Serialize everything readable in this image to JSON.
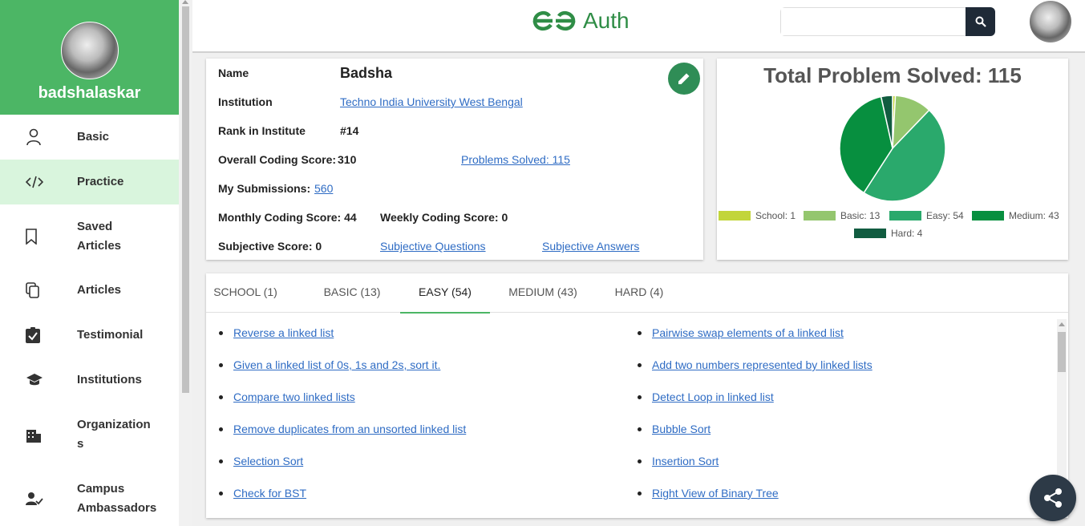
{
  "sidebar": {
    "username": "badshalaskar",
    "items": [
      {
        "label": "Basic",
        "icon": "person-icon"
      },
      {
        "label": "Practice",
        "icon": "code-icon",
        "active": true
      },
      {
        "label": "Saved Articles",
        "icon": "bookmark-icon"
      },
      {
        "label": "Articles",
        "icon": "copy-icon"
      },
      {
        "label": "Testimonial",
        "icon": "clipboard-check-icon"
      },
      {
        "label": "Institutions",
        "icon": "school-icon"
      },
      {
        "label": "Organizations",
        "icon": "building-icon"
      },
      {
        "label": "Campus Ambassadors",
        "icon": "person-check-icon"
      }
    ]
  },
  "header": {
    "brand": "Auth",
    "search_placeholder": ""
  },
  "profile": {
    "name_label": "Name",
    "name": "Badsha",
    "institution_label": "Institution",
    "institution": "Techno India University West Bengal",
    "rank_label": "Rank in Institute",
    "rank": "#14",
    "overall_label": "Overall Coding Score:",
    "overall": "310",
    "problems_solved_link": "Problems Solved: 115",
    "submissions_label": "My Submissions:",
    "submissions": "560",
    "monthly": "Monthly Coding Score: 44",
    "weekly": "Weekly Coding Score: 0",
    "subjective": "Subjective Score: 0",
    "subjective_questions": "Subjective Questions",
    "subjective_answers": "Subjective Answers"
  },
  "chart_title": "Total Problem Solved: 115",
  "chart_data": {
    "type": "pie",
    "categories": [
      "School",
      "Basic",
      "Easy",
      "Medium",
      "Hard"
    ],
    "values": [
      1,
      13,
      54,
      43,
      4
    ],
    "colors": [
      "#c2d53a",
      "#94c66e",
      "#2aa96c",
      "#078f3f",
      "#115c40"
    ],
    "legend_labels": [
      "School: 1",
      "Basic: 13",
      "Easy: 54",
      "Medium: 43",
      "Hard: 4"
    ],
    "legend_position": "bottom"
  },
  "tabs": [
    {
      "label": "SCHOOL (1)"
    },
    {
      "label": "BASIC (13)"
    },
    {
      "label": "EASY (54)",
      "active": true
    },
    {
      "label": "MEDIUM (43)"
    },
    {
      "label": "HARD (4)"
    }
  ],
  "problems_left": [
    "Reverse a linked list",
    "Given a linked list of 0s, 1s and 2s, sort it.",
    "Compare two linked lists",
    "Remove duplicates from an unsorted linked list",
    "Selection Sort",
    "Check for BST"
  ],
  "problems_right": [
    "Pairwise swap elements of a linked list",
    "Add two numbers represented by linked lists",
    "Detect Loop in linked list",
    "Bubble Sort",
    "Insertion Sort",
    "Right View of Binary Tree"
  ]
}
